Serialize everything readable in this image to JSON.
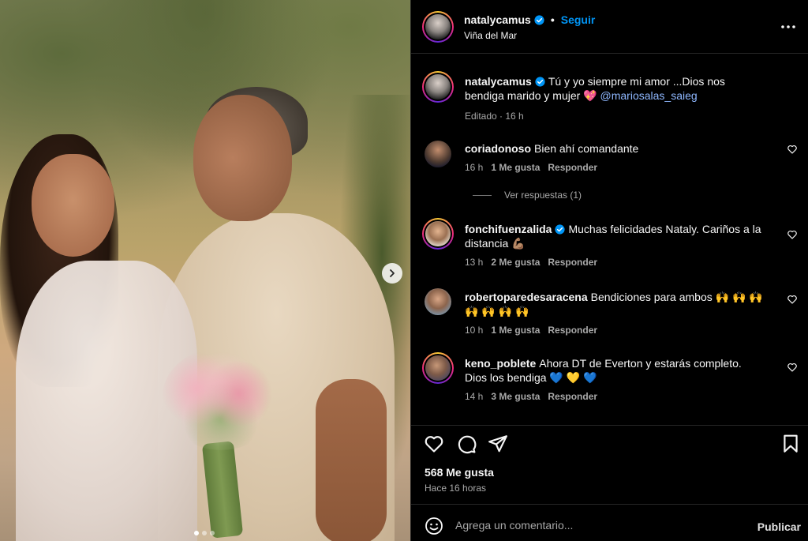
{
  "post": {
    "username": "natalycamus",
    "location": "Viña del Mar",
    "follow_label": "Seguir",
    "separator": "•",
    "carousel": {
      "current": 1,
      "total": 3
    }
  },
  "caption": {
    "username": "natalycamus",
    "text": "Tú y yo siempre mi amor ...Dios nos bendiga marido y mujer 💖",
    "mention": "@mariosalas_saieg",
    "meta": "Editado · 16 h"
  },
  "comments": [
    {
      "username": "coriadonoso",
      "text": "Bien ahí comandante",
      "time": "16 h",
      "likes": "1 Me gusta",
      "reply": "Responder",
      "view_replies": "Ver respuestas (1)"
    },
    {
      "username": "fonchifuenzalida",
      "verified": true,
      "text": "Muchas felicidades Nataly. Cariños a la distancia 💪🏽",
      "time": "13 h",
      "likes": "2 Me gusta",
      "reply": "Responder"
    },
    {
      "username": "robertoparedesaracena",
      "text": "Bendiciones para ambos 🙌 🙌 🙌 🙌 🙌 🙌 🙌",
      "time": "10 h",
      "likes": "1 Me gusta",
      "reply": "Responder"
    },
    {
      "username": "keno_poblete",
      "text": "Ahora DT de Everton y estarás completo. Dios los bendiga 💙 💛 💙",
      "time": "14 h",
      "likes": "3 Me gusta",
      "reply": "Responder"
    }
  ],
  "stats": {
    "likes": "568 Me gusta",
    "time_ago": "Hace 16 horas"
  },
  "composer": {
    "placeholder": "Agrega un comentario...",
    "publish_label": "Publicar"
  },
  "colors": {
    "accent": "#0095f6",
    "background": "#000000",
    "muted": "#a8a8a8"
  },
  "icons": [
    "verified-icon",
    "more-icon",
    "heart-icon",
    "comment-icon",
    "share-icon",
    "bookmark-icon",
    "emoji-icon",
    "chevron-right-icon"
  ]
}
